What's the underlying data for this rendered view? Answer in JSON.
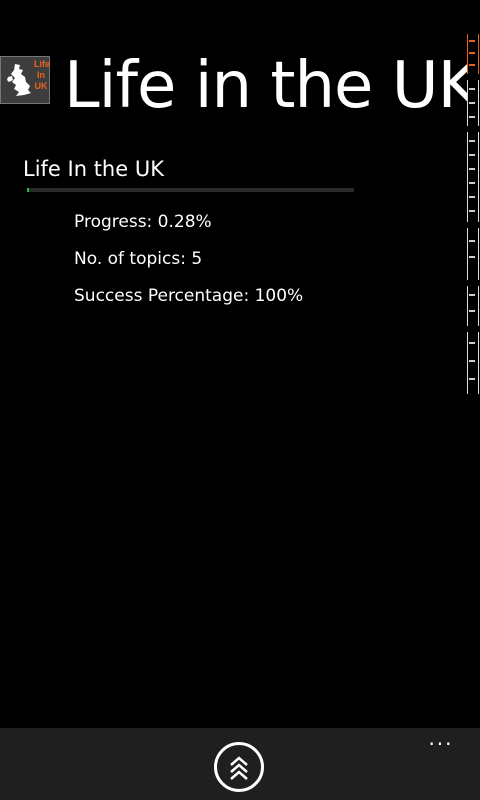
{
  "header": {
    "logo_text": "Life In UK",
    "title": "Life in the UK"
  },
  "course": {
    "title": "Life In the UK",
    "progress_percent": 0.28,
    "progress_text": "Progress: 0.28%",
    "topics_text": "No. of topics: 5",
    "success_text": "Success Percentage: 100%"
  },
  "app_bar": {
    "menu_icon": "chevron-up-icon",
    "more_label": "..."
  },
  "colors": {
    "background": "#000000",
    "accent_orange": "#e8621e",
    "progress_green": "#1bbf33",
    "app_bar": "#1f1f1f"
  }
}
